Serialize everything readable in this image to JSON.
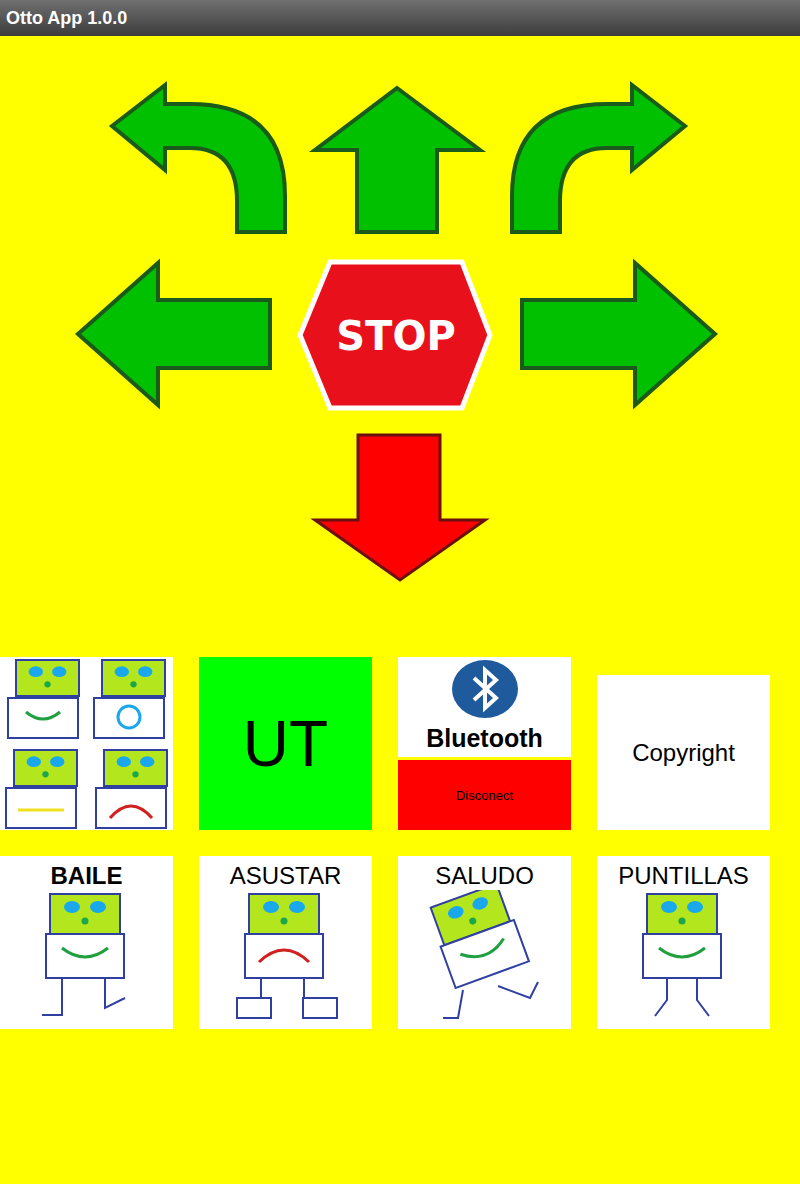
{
  "window": {
    "title": "Otto App 1.0.0"
  },
  "controls": {
    "stop": "STOP"
  },
  "tiles": {
    "ut": "UT",
    "bluetooth": {
      "label": "Bluetooth",
      "status": "Disconect",
      "connected": false
    },
    "copyright": "Copyright"
  },
  "actions": [
    {
      "label": "BAILE",
      "bold": true
    },
    {
      "label": "ASUSTAR",
      "bold": false
    },
    {
      "label": "SALUDO",
      "bold": false
    },
    {
      "label": "PUNTILLAS",
      "bold": false
    }
  ]
}
